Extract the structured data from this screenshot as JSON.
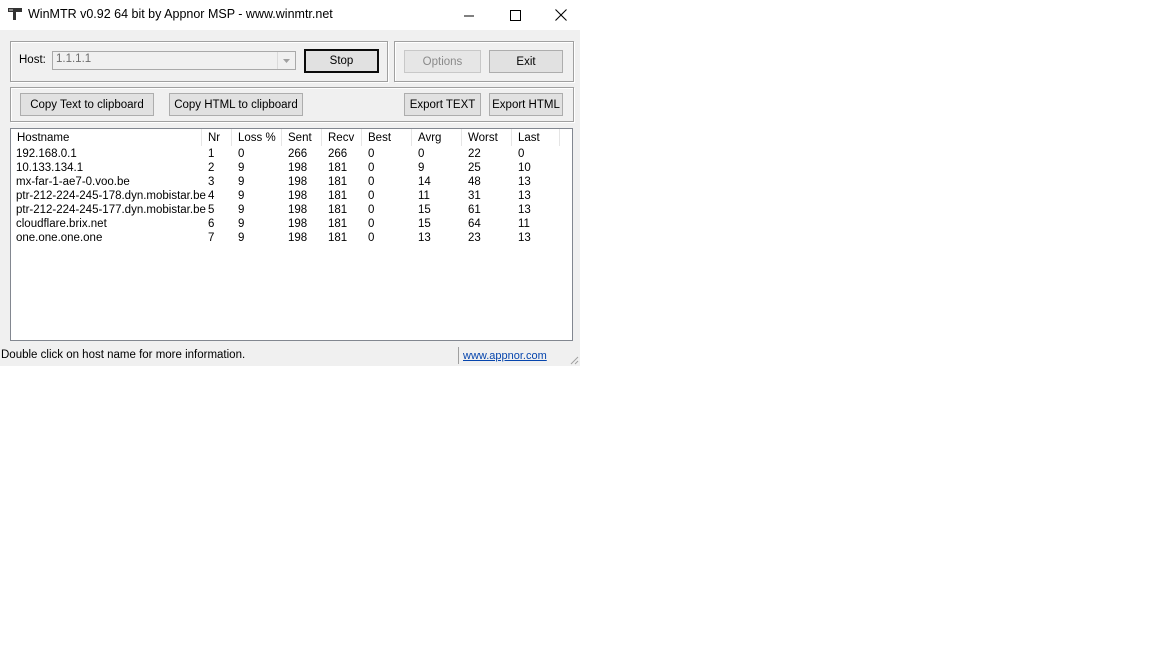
{
  "window": {
    "title": "WinMTR v0.92 64 bit by Appnor MSP - www.winmtr.net",
    "app_icon": "hammer-icon"
  },
  "toolbar": {
    "host_label": "Host:",
    "host_value": "1.1.1.1",
    "stop_label": "Stop",
    "options_label": "Options",
    "exit_label": "Exit",
    "copy_text_label": "Copy Text to clipboard",
    "copy_html_label": "Copy HTML to clipboard",
    "export_text_label": "Export TEXT",
    "export_html_label": "Export HTML"
  },
  "table": {
    "columns": [
      "Hostname",
      "Nr",
      "Loss %",
      "Sent",
      "Recv",
      "Best",
      "Avrg",
      "Worst",
      "Last"
    ],
    "rows": [
      [
        "192.168.0.1",
        "1",
        "0",
        "266",
        "266",
        "0",
        "0",
        "22",
        "0"
      ],
      [
        "10.133.134.1",
        "2",
        "9",
        "198",
        "181",
        "0",
        "9",
        "25",
        "10"
      ],
      [
        "mx-far-1-ae7-0.voo.be",
        "3",
        "9",
        "198",
        "181",
        "0",
        "14",
        "48",
        "13"
      ],
      [
        "ptr-212-224-245-178.dyn.mobistar.be",
        "4",
        "9",
        "198",
        "181",
        "0",
        "11",
        "31",
        "13"
      ],
      [
        "ptr-212-224-245-177.dyn.mobistar.be",
        "5",
        "9",
        "198",
        "181",
        "0",
        "15",
        "61",
        "13"
      ],
      [
        "cloudflare.brix.net",
        "6",
        "9",
        "198",
        "181",
        "0",
        "15",
        "64",
        "11"
      ],
      [
        "one.one.one.one",
        "7",
        "9",
        "198",
        "181",
        "0",
        "13",
        "23",
        "13"
      ]
    ]
  },
  "statusbar": {
    "message": "Double click on host name for more information.",
    "link": "www.appnor.com"
  },
  "colors": {
    "window_bg": "#f0f0f0",
    "button_bg": "#e1e1e1",
    "link": "#0645ad"
  }
}
